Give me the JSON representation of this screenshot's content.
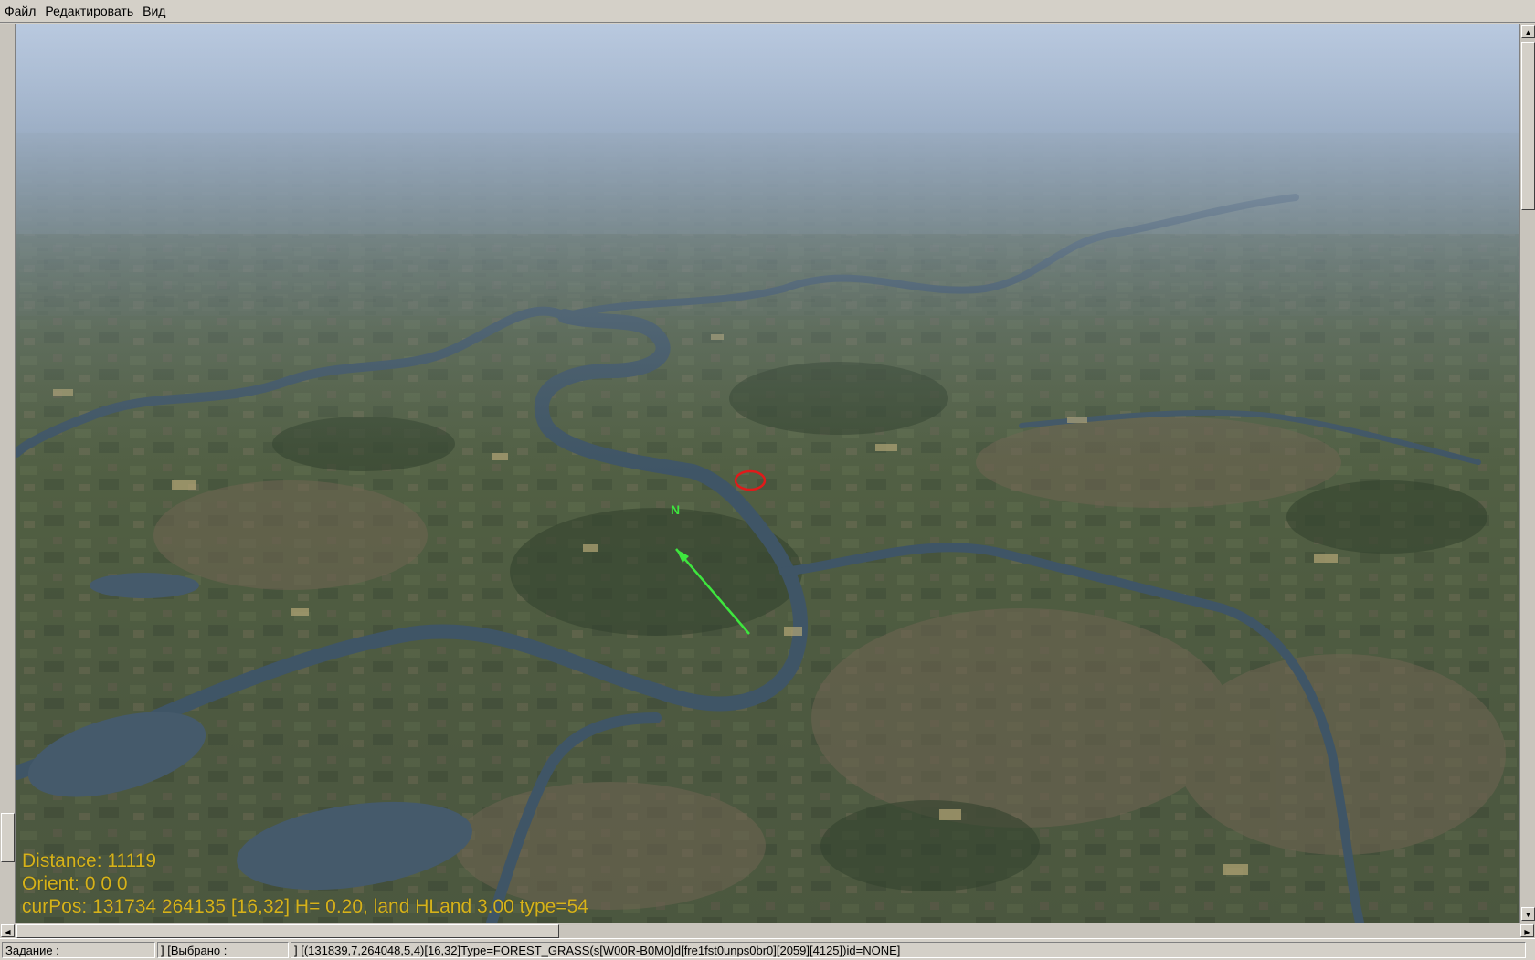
{
  "menu": {
    "items": [
      "Файл",
      "Редактировать",
      "Вид"
    ]
  },
  "hud": {
    "distance": "Distance: 11119",
    "orient": "Orient: 0 0 0",
    "curpos": "curPos: 131734 264135 [16,32] H= 0.20, land HLand 3.00 type=54"
  },
  "viewport_marker": {
    "compass_label": "N",
    "arrow_color": "#3ee63e",
    "target_circle_color": "#e01a1a"
  },
  "status": {
    "task": "Задание :",
    "selected": "] [Выбрано :",
    "info": "] [(131839,7,264048,5,4)[16,32]Type=FOREST_GRASS(s[W00R-B0M0]d[fre1fst0unps0br0][2059][4125])id=NONE]"
  },
  "colors": {
    "hud_text": "#d6b21a",
    "ui_face": "#d4d0c8"
  },
  "icons": {
    "scroll_up": "triangle-up-icon",
    "scroll_down": "triangle-down-icon",
    "scroll_left": "triangle-left-icon",
    "scroll_right": "triangle-right-icon"
  }
}
